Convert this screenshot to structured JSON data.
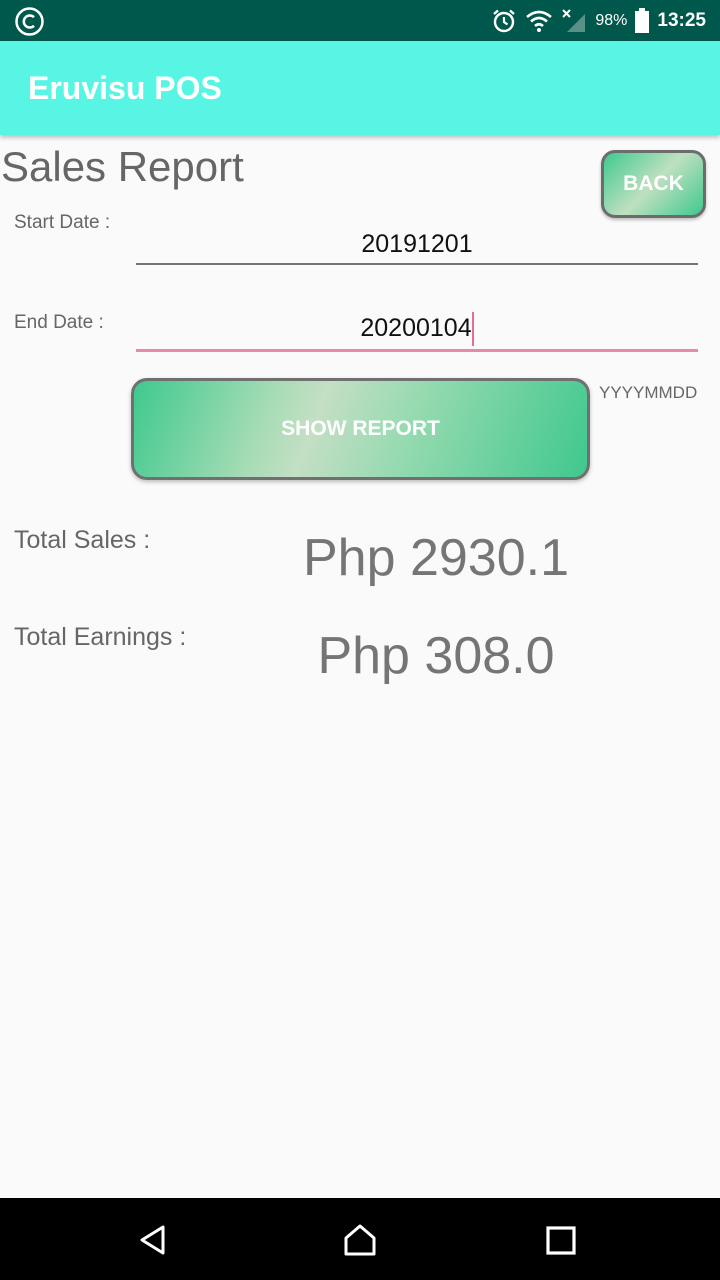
{
  "status_bar": {
    "battery": "98%",
    "time": "13:25",
    "icons": [
      "copyright-icon",
      "alarm-icon",
      "wifi-icon",
      "signal-icon",
      "battery-icon"
    ]
  },
  "app": {
    "title": "Eruvisu POS",
    "accent": "#58f5e5",
    "status_bar_color": "#00574b"
  },
  "page": {
    "title": "Sales Report",
    "back_label": "BACK"
  },
  "form": {
    "start_label": "Start Date :",
    "start_value": "20191201",
    "end_label": "End Date :",
    "end_value": "20200104",
    "show_report_label": "SHOW REPORT",
    "format_hint": "YYYYMMDD"
  },
  "totals": {
    "sales_label": "Total Sales :",
    "sales_value": "Php 2930.1",
    "earnings_label": "Total Earnings :",
    "earnings_value": "Php 308.0"
  },
  "nav": {
    "icons": [
      "back-icon",
      "home-icon",
      "recents-icon"
    ]
  }
}
